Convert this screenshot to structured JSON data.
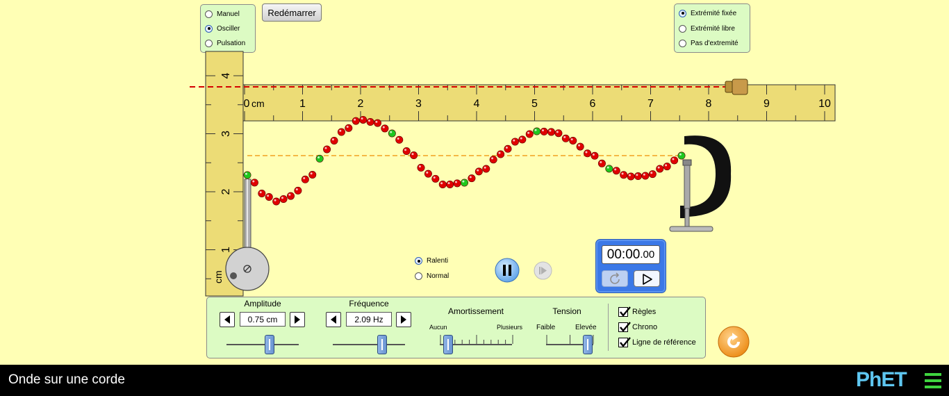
{
  "mode_panel": {
    "options": [
      {
        "label": "Manuel",
        "selected": false
      },
      {
        "label": "Osciller",
        "selected": true
      },
      {
        "label": "Pulsation",
        "selected": false
      }
    ]
  },
  "restart_button": {
    "label": "Redémarrer"
  },
  "end_panel": {
    "options": [
      {
        "label": "Extrémité fixée",
        "selected": true
      },
      {
        "label": "Extrémité libre",
        "selected": false
      },
      {
        "label": "Pas d'extremité",
        "selected": false
      }
    ]
  },
  "horizontal_ruler": {
    "unit": "cm",
    "ticks": [
      "0",
      "1",
      "2",
      "3",
      "4",
      "5",
      "6",
      "7",
      "8",
      "9",
      "10"
    ]
  },
  "vertical_ruler": {
    "unit": "cm",
    "ticks": [
      "1",
      "2",
      "3",
      "4"
    ]
  },
  "speed": {
    "options": [
      {
        "label": "Ralenti",
        "selected": true
      },
      {
        "label": "Normal",
        "selected": false
      }
    ]
  },
  "stopwatch": {
    "main": "00:00",
    "fraction": ".00"
  },
  "controls": {
    "amplitude": {
      "label": "Amplitude",
      "value": "0.75 cm",
      "level": 0.6
    },
    "frequency": {
      "label": "Fréquence",
      "value": "2.09 Hz",
      "level": 0.68
    },
    "damping": {
      "label": "Amortissement",
      "min_label": "Aucun",
      "max_label": "Plusieurs",
      "level": 0.12
    },
    "tension": {
      "label": "Tension",
      "min_label": "Faible",
      "max_label": "Elevée",
      "level": 0.88
    }
  },
  "checkboxes": [
    {
      "label": "Règles",
      "checked": true
    },
    {
      "label": "Chrono",
      "checked": true
    },
    {
      "label": "Ligne de référence",
      "checked": true
    }
  ],
  "footer": {
    "title": "Onde sur une corde",
    "logo": "PhET"
  },
  "colors": {
    "background": "#ffffb5",
    "panel": "#dcfbc3",
    "ruler": "#ecdc76",
    "bead_red": "#e00000",
    "bead_green": "#1ec81e",
    "reference_line": "#d40000",
    "equilibrium_line": "#f0a020",
    "reset": "#f39a1e"
  }
}
